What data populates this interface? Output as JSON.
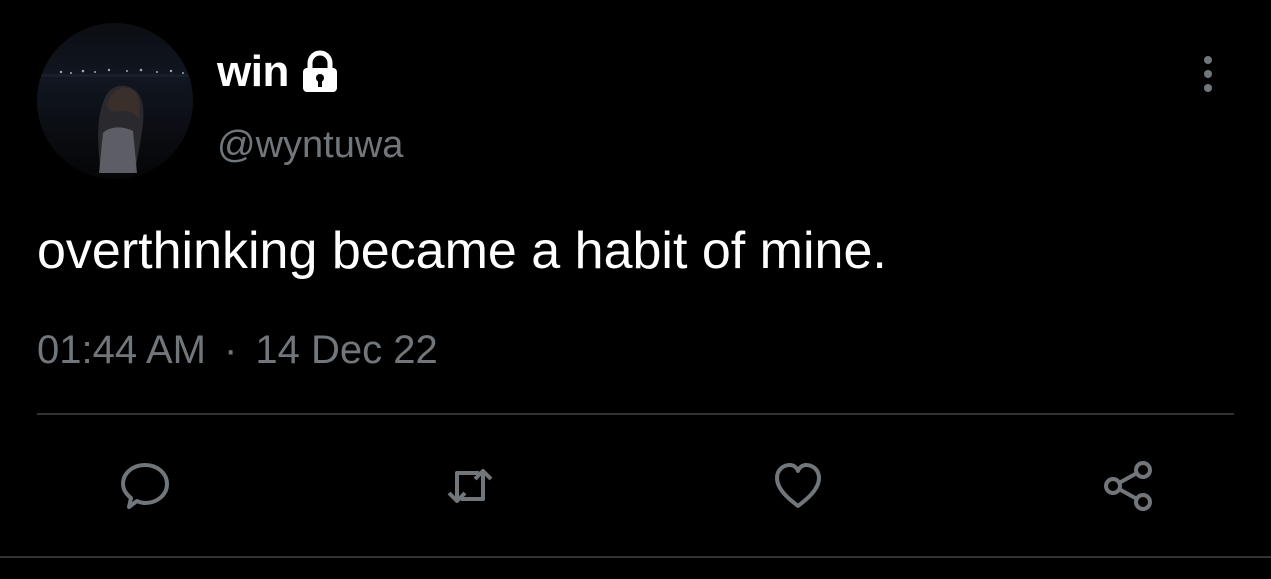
{
  "tweet": {
    "author": {
      "display_name": "win",
      "handle": "@wyntuwa",
      "avatar_icon": "profile-photo",
      "protected_icon": "lock-icon"
    },
    "text": "overthinking became a habit of mine.",
    "time": "01:44 AM",
    "separator": "·",
    "date": "14 Dec 22"
  },
  "actions": [
    {
      "name": "reply",
      "icon": "speech-bubble-icon"
    },
    {
      "name": "retweet",
      "icon": "retweet-icon"
    },
    {
      "name": "like",
      "icon": "heart-icon"
    },
    {
      "name": "share",
      "icon": "share-icon"
    }
  ],
  "menu": {
    "icon": "more-vertical-icon"
  },
  "colors": {
    "background": "#000000",
    "text_primary": "#ffffff",
    "text_secondary": "#71767b",
    "divider": "#2f3336"
  }
}
